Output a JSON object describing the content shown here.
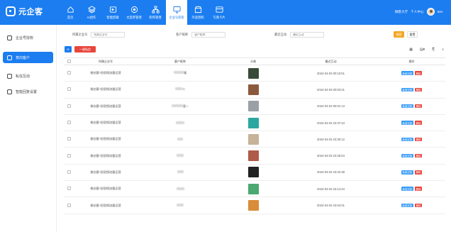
{
  "app": {
    "logo_text": "元企客"
  },
  "nav": [
    {
      "label": "首页",
      "icon": "home-icon"
    },
    {
      "label": "AI创作",
      "icon": "layers-icon"
    },
    {
      "label": "智能剪辑",
      "icon": "clip-icon"
    },
    {
      "label": "文案库管理",
      "icon": "target-icon"
    },
    {
      "label": "矩阵管理",
      "icon": "matrix-icon"
    },
    {
      "label": "企业号获客",
      "icon": "monitor-icon"
    },
    {
      "label": "外卖团购",
      "icon": "store-icon"
    },
    {
      "label": "写真卡片",
      "icon": "card-icon"
    }
  ],
  "user": {
    "shop": "微客大厅",
    "center": "个人中心",
    "name": "test"
  },
  "sidebar": [
    {
      "label": "企业号授权"
    },
    {
      "label": "意向客户"
    },
    {
      "label": "私信互动"
    },
    {
      "label": "智能回复设置"
    }
  ],
  "filters": [
    {
      "label": "所属企业号",
      "placeholder": "所属企业号"
    },
    {
      "label": "客户昵称",
      "placeholder": "客户昵称"
    },
    {
      "label": "最近互动",
      "placeholder": "最近互动"
    }
  ],
  "buttons": {
    "search": "搜索",
    "reset": "重置",
    "batch": "一键私信"
  },
  "table": {
    "headers": [
      "",
      "所属企业号",
      "客户昵称",
      "头像",
      "最近互动",
      "操作"
    ],
    "op_labels": [
      "私信记录",
      "删除"
    ],
    "rows": [
      {
        "account": "微创客-短视频流量运营",
        "nickname_suffix": "隆",
        "time": "2024-04-03 00:10:51",
        "avatar_color": "#3a4a3a"
      },
      {
        "account": "微创客-短视频流量运营",
        "nickname_suffix": "二",
        "time": "2024-04-03 00:03:31",
        "avatar_color": "#8b5a3c"
      },
      {
        "account": "微创客-短视频流量运营",
        "nickname_suffix": "星☆",
        "time": "2024-04-03 00:01:13",
        "avatar_color": "#9aa0a6"
      },
      {
        "account": "微创客-短视频流量运营",
        "nickname_suffix": "",
        "time": "2024-04-03 23:37:43",
        "avatar_color": "#2aa7a0"
      },
      {
        "account": "微创客-短视频流量运营",
        "nickname_suffix": "",
        "time": "2024-04-03 23:30:12",
        "avatar_color": "#c7b29a"
      },
      {
        "account": "微创客-短视频流量运营",
        "nickname_suffix": "",
        "time": "2024-04-03 23:26:04",
        "avatar_color": "#b05a4a"
      },
      {
        "account": "微创客-短视频流量运营",
        "nickname_suffix": "",
        "time": "2024-04-03 23:22:38",
        "avatar_color": "#222222"
      },
      {
        "account": "微创客-短视频流量运营",
        "nickname_suffix": "",
        "time": "2024-04-03 23:14:34",
        "avatar_color": "#4aa870"
      },
      {
        "account": "微创客-短视频流量运营",
        "nickname_suffix": "",
        "time": "2024-04-03 23:04:01",
        "avatar_color": "#d98c3a"
      }
    ]
  },
  "colors": {
    "primary": "#1b7df0",
    "warning": "#f5a623",
    "danger": "#e8463c",
    "info": "#3b9df5"
  }
}
